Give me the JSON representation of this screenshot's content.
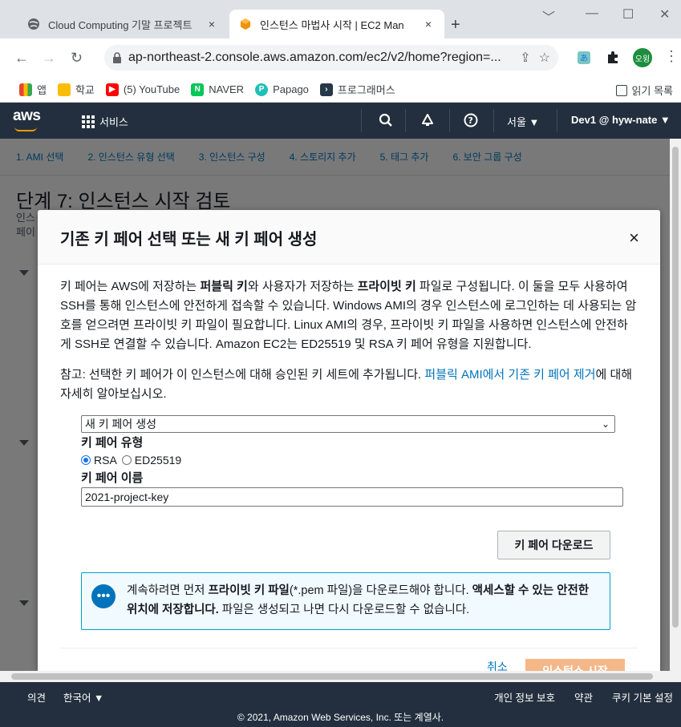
{
  "browser": {
    "tabs": [
      {
        "title": "Cloud Computing 기말 프로젝트",
        "close": "×"
      },
      {
        "title": "인스턴스 마법사 시작 | EC2 Man",
        "close": "×"
      }
    ],
    "new_tab": "+",
    "url": "ap-northeast-2.console.aws.amazon.com/ec2/v2/home?region=...",
    "profile_label": "오윙",
    "bookmarks": [
      {
        "label": "앱",
        "color": "#ea4335"
      },
      {
        "label": "학교",
        "color": "#fbbc04"
      },
      {
        "label": "(5) YouTube",
        "color": "#ff0000"
      },
      {
        "label": "NAVER",
        "color": "#03c75a"
      },
      {
        "label": "Papago",
        "color": "#21c0b6"
      },
      {
        "label": "프로그래머스",
        "color": "#263747"
      }
    ],
    "reading_list": "읽기 목록"
  },
  "aws_nav": {
    "logo": "aws",
    "services": "서비스",
    "region": "서울 ▼",
    "account": "Dev1 @ hyw-nate ▼"
  },
  "page": {
    "steps": [
      "1. AMI 선택",
      "2. 인스턴스 유형 선택",
      "3. 인스턴스 구성",
      "4. 스토리지 추가",
      "5. 태그 추가",
      "6. 보안 그룹 구성"
    ],
    "title": "단계 7: 인스턴스 시작 검토",
    "snippet_1": "인스",
    "snippet_2": "페이"
  },
  "modal": {
    "title": "기존 키 페어 선택 또는 새 키 페어 생성",
    "close": "×",
    "intro": {
      "t1": "키 페어는 AWS에 저장하는 ",
      "b1": "퍼블릭 키",
      "t2": "와 사용자가 저장하는 ",
      "b2": "프라이빗 키",
      "t3": " 파일로 구성됩니다. 이 둘을 모두 사용하여 SSH를 통해 인스턴스에 안전하게 접속할 수 있습니다. Windows AMI의 경우 인스턴스에 로그인하는 데 사용되는 암호를 얻으려면 프라이빗 키 파일이 필요합니다. Linux AMI의 경우, 프라이빗 키 파일을 사용하면 인스턴스에 안전하게 SSH로 연결할 수 있습니다. Amazon EC2는 ED25519 및 RSA 키 페어 유형을 지원합니다."
    },
    "note": {
      "t1": "참고: 선택한 키 페어가 이 인스턴스에 대해 승인된 키 세트에 추가됩니다. ",
      "link": "퍼블릭 AMI에서 기존 키 페어 제거",
      "t2": "에 대해 자세히 알아보십시오."
    },
    "select_value": "새 키 페어 생성",
    "key_type_label": "키 페어 유형",
    "radio_rsa": "RSA",
    "radio_ed": "ED25519",
    "key_name_label": "키 페어 이름",
    "key_name_value": "2021-project-key",
    "download_button": "키 페어 다운로드",
    "info": {
      "t1": "계속하려면 먼저 ",
      "b1": "프라이빗 키 파일",
      "t2": "(*.pem 파일)을 다운로드해야 합니다. ",
      "b2": "액세스할 수 있는 안전한 위치에 저장합니다.",
      "t3": " 파일은 생성되고 나면 다시 다운로드할 수 없습니다."
    },
    "cancel": "취소",
    "launch": "인스턴스 시작"
  },
  "footer": {
    "feedback": "의견",
    "language": "한국어 ▼",
    "privacy": "개인 정보 보호",
    "terms": "약관",
    "cookies": "쿠키 기본 설정",
    "copyright": "© 2021, Amazon Web Services, Inc. 또는 계열사."
  }
}
